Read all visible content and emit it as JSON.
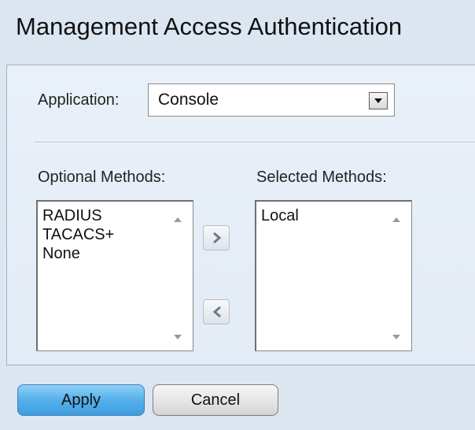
{
  "page": {
    "title": "Management Access Authentication"
  },
  "application": {
    "label": "Application:",
    "selected": "Console"
  },
  "optional_methods": {
    "label": "Optional Methods:",
    "items": [
      "RADIUS",
      "TACACS+",
      "None"
    ]
  },
  "selected_methods": {
    "label": "Selected Methods:",
    "items": [
      "Local"
    ]
  },
  "buttons": {
    "apply": "Apply",
    "cancel": "Cancel"
  },
  "icons": {
    "move_right": "arrow-right-icon",
    "move_left": "arrow-left-icon",
    "dropdown": "chevron-down-icon"
  }
}
